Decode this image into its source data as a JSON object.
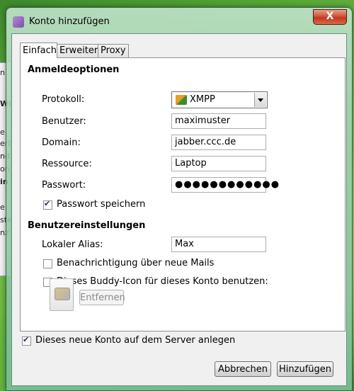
{
  "window": {
    "title": "Konto hinzufügen",
    "close_label": "X"
  },
  "tabs": [
    {
      "label": "Einfach",
      "active": true
    },
    {
      "label": "Erweitert",
      "active": false
    },
    {
      "label": "Proxy",
      "active": false
    }
  ],
  "login_options": {
    "heading": "Anmeldeoptionen",
    "protocol_label": "Protokoll:",
    "protocol_value": "XMPP",
    "user_label": "Benutzer:",
    "user_value": "maximuster",
    "domain_label": "Domain:",
    "domain_value": "jabber.ccc.de",
    "resource_label": "Ressource:",
    "resource_value": "Laptop",
    "password_label": "Passwort:",
    "password_value": "●●●●●●●●●●●●",
    "remember_password_label": "Passwort speichern",
    "remember_password_checked": true
  },
  "user_settings": {
    "heading": "Benutzereinstellungen",
    "alias_label": "Lokaler Alias:",
    "alias_value": "Max",
    "mail_notify_label": "Benachrichtigung über neue Mails",
    "mail_notify_checked": false,
    "buddy_icon_label": "Dieses Buddy-Icon für dieses Konto benutzen:",
    "buddy_icon_checked": false,
    "remove_label": "Entfernen"
  },
  "footer": {
    "create_on_server_label": "Dieses neue Konto auf dem Server anlegen",
    "create_on_server_checked": true,
    "cancel_label": "Abbrechen",
    "add_label": "Hinzufügen"
  },
  "background_window_fragments": [
    "n",
    "Wi",
    "e",
    "erb",
    "nd",
    "on",
    "in",
    "e",
    "ste",
    "nz"
  ]
}
